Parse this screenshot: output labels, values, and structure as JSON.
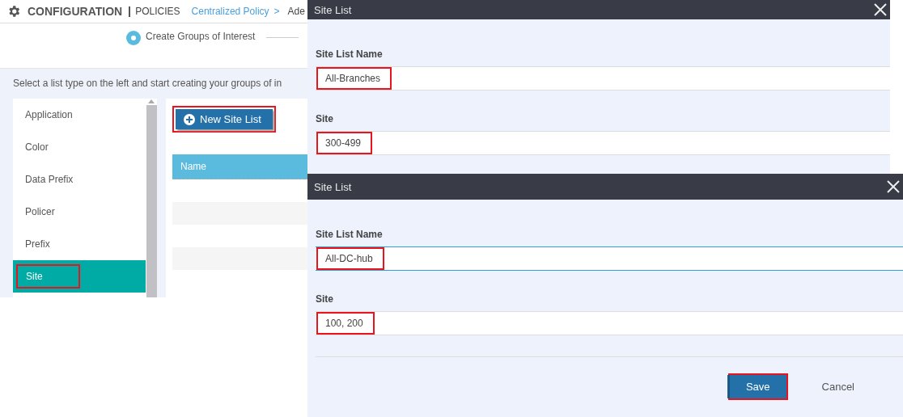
{
  "header": {
    "title": "CONFIGURATION",
    "section": "POLICIES",
    "breadcrumb": {
      "link": "Centralized Policy",
      "separator": ">",
      "current": "Ade"
    }
  },
  "step": {
    "label": "Create Groups of Interest",
    "active": true
  },
  "instruction": "Select a list type on the left and start creating your groups of in",
  "list_types": [
    {
      "label": "Application",
      "selected": false,
      "highlighted": false
    },
    {
      "label": "Color",
      "selected": false,
      "highlighted": false
    },
    {
      "label": "Data Prefix",
      "selected": false,
      "highlighted": false
    },
    {
      "label": "Policer",
      "selected": false,
      "highlighted": false
    },
    {
      "label": "Prefix",
      "selected": false,
      "highlighted": false
    },
    {
      "label": "Site",
      "selected": true,
      "highlighted": true
    }
  ],
  "new_button": {
    "label": "New Site List",
    "highlighted": true
  },
  "table": {
    "columns": [
      "Name"
    ]
  },
  "dialogs": [
    {
      "title": "Site List",
      "fields": [
        {
          "label": "Site List Name",
          "value": "All-Branches",
          "focused": false,
          "highlighted": true
        },
        {
          "label": "Site",
          "value": "300-499",
          "focused": false,
          "highlighted": true
        }
      ]
    },
    {
      "title": "Site List",
      "fields": [
        {
          "label": "Site List Name",
          "value": "All-DC-hub",
          "focused": true,
          "highlighted": true
        },
        {
          "label": "Site",
          "value": "100, 200",
          "focused": false,
          "highlighted": true
        }
      ],
      "buttons": [
        {
          "label": "Save",
          "kind": "primary",
          "highlighted": true
        },
        {
          "label": "Cancel",
          "kind": "secondary",
          "highlighted": false
        }
      ]
    }
  ]
}
